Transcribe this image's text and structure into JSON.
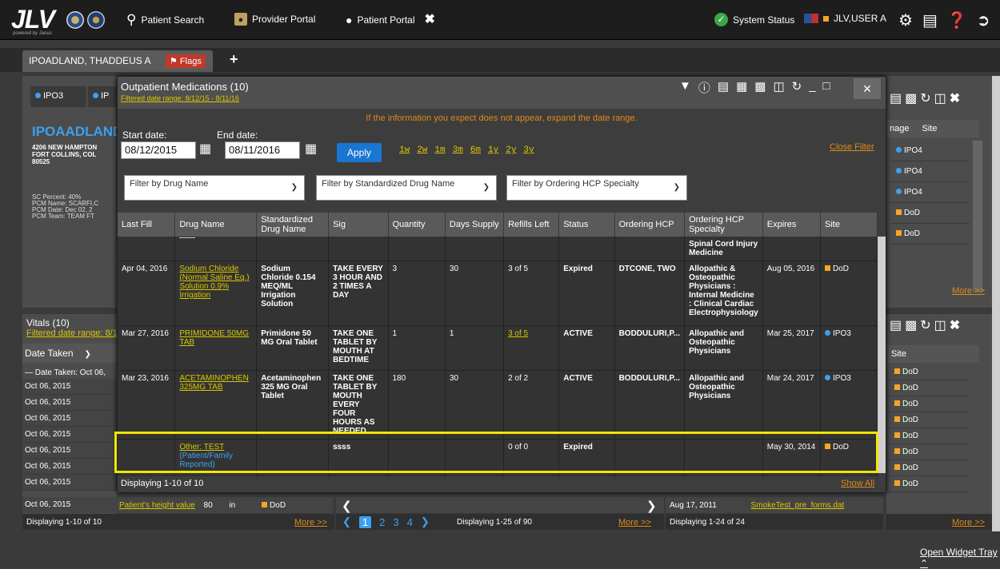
{
  "header": {
    "logo": "JLV",
    "logo_sub": "powered by Janus",
    "nav": [
      {
        "label": "Patient Search",
        "icon": "search-icon"
      },
      {
        "label": "Provider Portal",
        "icon": "provider-icon"
      },
      {
        "label": "Patient Portal",
        "icon": "user-icon"
      }
    ],
    "system_status": "System Status",
    "user": "JLV,USER A"
  },
  "patient_tab": {
    "name": "IPOADLAND, THADDEUS A",
    "flags": "Flags"
  },
  "background": {
    "site_tabs": [
      "IPO3",
      "IP"
    ],
    "patient_name": "IPOAADLAND,",
    "address1": "4206 NEW HAMPTON",
    "address2": "FORT COLLINS, COL",
    "zip": "80525",
    "sc_percent": "SC Percent:  40%",
    "pcm_name": "PCM Name:  SCARFI,C",
    "pcm_date": "PCM Date:   Dec 02, 2",
    "pcm_team": "PCM Team:  TEAM FT",
    "vitals_title": "Vitals (10)",
    "vitals_range": "Filtered date range: 8/1",
    "vitals_col": "Date Taken",
    "vitals_group": "Date Taken: Oct 06,",
    "vitals_rows": [
      "Oct 06, 2015",
      "Oct 06, 2015",
      "Oct 06, 2015",
      "Oct 06, 2015",
      "Oct 06, 2015",
      "Oct 06, 2015",
      "Oct 06, 2015"
    ],
    "vitals_bottom": {
      "name": "Patient's height value",
      "value": "80",
      "unit": "in",
      "site": "DoD"
    },
    "vitals_footer": "Displaying 1-10 of 10",
    "vitals_more": "More >>",
    "middle_footer": "Displaying 1-25 of 90",
    "middle_more": "More >>",
    "pager": [
      "1",
      "2",
      "3",
      "4"
    ],
    "docs_row": {
      "date": "Aug 17, 2011",
      "title": "SmokeTest_pre_forms.dat"
    },
    "docs_footer": "Displaying 1-24 of 24",
    "right_top": {
      "col1": "nage",
      "col2": "Site",
      "sites": [
        "IPO4",
        "IPO4",
        "IPO4",
        "DoD",
        "DoD"
      ],
      "more": "More >>"
    },
    "right_bottom": {
      "col": "Site",
      "sites": [
        "DoD",
        "DoD",
        "DoD",
        "DoD",
        "DoD",
        "DoD",
        "DoD",
        "DoD"
      ],
      "more": "More >>"
    }
  },
  "modal": {
    "title": "Outpatient Medications (10)",
    "filtered_range": "Filtered date range: 8/12/15 - 8/11/16",
    "hint": "If the information you expect does not appear, expand the date range.",
    "start_label": "Start date:",
    "end_label": "End date:",
    "start_value": "08/12/2015",
    "end_value": "08/11/2016",
    "apply": "Apply",
    "quick_ranges": [
      "1w",
      "2w",
      "1m",
      "3m",
      "6m",
      "1y",
      "2y",
      "3y"
    ],
    "close_filter": "Close Filter",
    "filters": [
      "Filter by Drug Name",
      "Filter by Standardized Drug Name",
      "Filter by Ordering HCP Specialty"
    ],
    "columns": [
      "Last Fill",
      "Drug Name",
      "Standardized Drug Name",
      "Sig",
      "Quantity",
      "Days Supply",
      "Refills Left",
      "Status",
      "Ordering HCP",
      "Ordering HCP Specialty",
      "Expires",
      "Site"
    ],
    "partial_row_specialty": "Spinal Cord Injury Medicine",
    "rows": [
      {
        "last_fill": "Apr 04, 2016",
        "drug": "Sodium Chloride (Normal Saline Eq.) Solution 0.9% Irrigation",
        "std": "Sodium Chloride 0.154 MEQ/ML Irrigation Solution",
        "sig": "TAKE EVERY 3 HOUR AND 2 TIMES A DAY",
        "qty": "3",
        "days": "30",
        "refills": "3 of 5",
        "refills_link": false,
        "status": "Expired",
        "hcp": "DTCONE, TWO",
        "specialty": "Allopathic & Osteopathic Physicians : Internal Medicine : Clinical Cardiac Electrophysiology",
        "expires": "Aug 05, 2016",
        "site": "DoD",
        "site_type": "square"
      },
      {
        "last_fill": "Mar 27, 2016",
        "drug": "PRIMIDONE 50MG TAB",
        "std": "Primidone 50 MG Oral Tablet",
        "sig": "TAKE ONE TABLET BY MOUTH AT BEDTIME",
        "qty": "1",
        "days": "1",
        "refills": "3 of 5",
        "refills_link": true,
        "status": "ACTIVE",
        "hcp": "BODDULURI,P...",
        "specialty": "Allopathic and Osteopathic Physicians",
        "expires": "Mar 25, 2017",
        "site": "IPO3",
        "site_type": "dot"
      },
      {
        "last_fill": "Mar 23, 2016",
        "drug": "ACETAMINOPHEN 325MG TAB",
        "std": "Acetaminophen 325 MG Oral Tablet",
        "sig": "TAKE ONE TABLET BY MOUTH EVERY FOUR HOURS AS NEEDED",
        "qty": "180",
        "days": "30",
        "refills": "2 of 2",
        "refills_link": false,
        "status": "ACTIVE",
        "hcp": "BODDULURI,P...",
        "specialty": "Allopathic and Osteopathic Physicians",
        "expires": "Mar 24, 2017",
        "site": "IPO3",
        "site_type": "dot"
      },
      {
        "last_fill": "",
        "drug": "Other: TEST",
        "drug_note": "(Patient/Family Reported)",
        "std": "",
        "sig": "ssss",
        "qty": "",
        "days": "",
        "refills": "0 of 0",
        "refills_link": false,
        "status": "Expired",
        "hcp": "",
        "specialty": "",
        "expires": "May 30, 2014",
        "site": "DoD",
        "site_type": "square"
      }
    ],
    "footer": "Displaying 1-10 of 10",
    "show_all": "Show All"
  },
  "widget_tray": "Open Widget Tray",
  "colors": {
    "accent_yellow": "#f2e600",
    "link_yellow": "#d9c800",
    "orange": "#e08a17",
    "dod": "#f5a623",
    "ipo": "#3da0f0"
  }
}
